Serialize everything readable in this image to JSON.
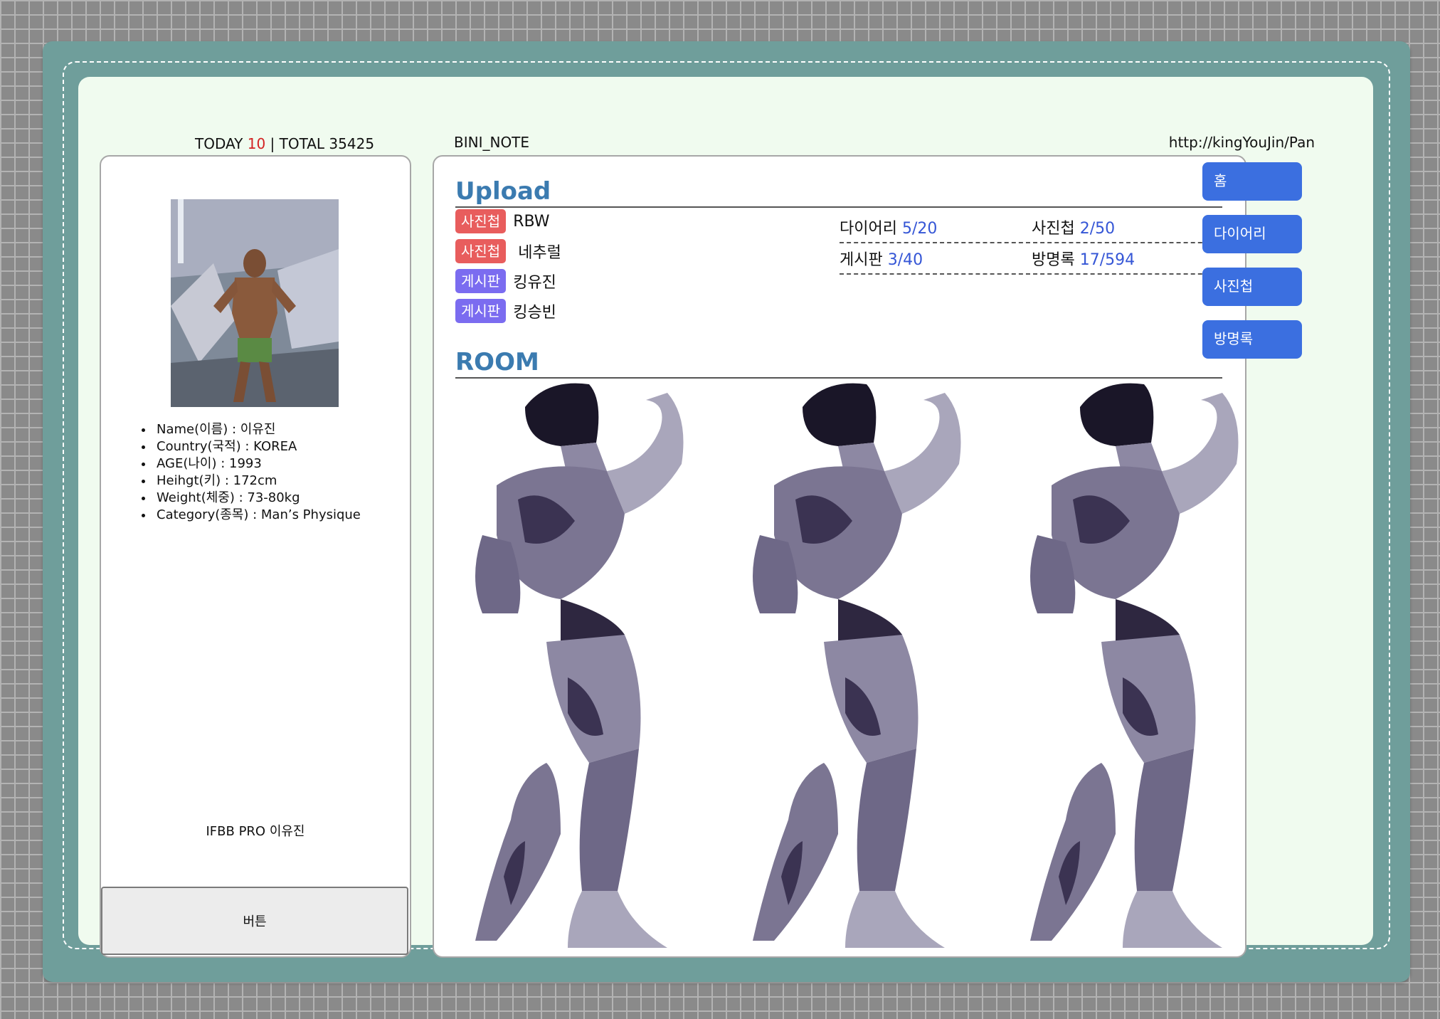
{
  "counter": {
    "today_label": "TODAY",
    "today_value": "10",
    "total_label": "| TOTAL 35425"
  },
  "header": {
    "title": "BINI_NOTE",
    "url": "http://kingYouJin/Pan"
  },
  "profile": {
    "items": [
      "Name(이름) : 이유진",
      "Country(국적) : KOREA",
      "AGE(나이) : 1993",
      "Heihgt(키) : 172cm",
      "Weight(체중) : 73-80kg",
      "Category(종목) : Man’s Physique"
    ],
    "caption": "IFBB PRO 이유진",
    "button_label": "버튼"
  },
  "upload": {
    "heading": "Upload",
    "items": [
      {
        "tag": "사진첩",
        "text": "RBW"
      },
      {
        "tag": "사진첩",
        "text": " 네추럴"
      },
      {
        "tag": "게시판",
        "text": "킹유진"
      },
      {
        "tag": "게시판",
        "text": "킹승빈"
      }
    ],
    "stats": [
      {
        "label": "다이어리",
        "value": "5/20"
      },
      {
        "label": "사진첩",
        "value": "2/50"
      },
      {
        "label": "게시판",
        "value": "3/40"
      },
      {
        "label": "방명록",
        "value": "17/594"
      }
    ]
  },
  "room": {
    "heading": "ROOM"
  },
  "nav": {
    "items": [
      "홈",
      "다이어리",
      "사진첩",
      "방명록"
    ]
  },
  "colors": {
    "accent": "#3b6fe0",
    "heading": "#3b7bb0",
    "tag_photo": "#e85d5d",
    "tag_board": "#7b6cf0",
    "frame": "#6f9e9b"
  }
}
